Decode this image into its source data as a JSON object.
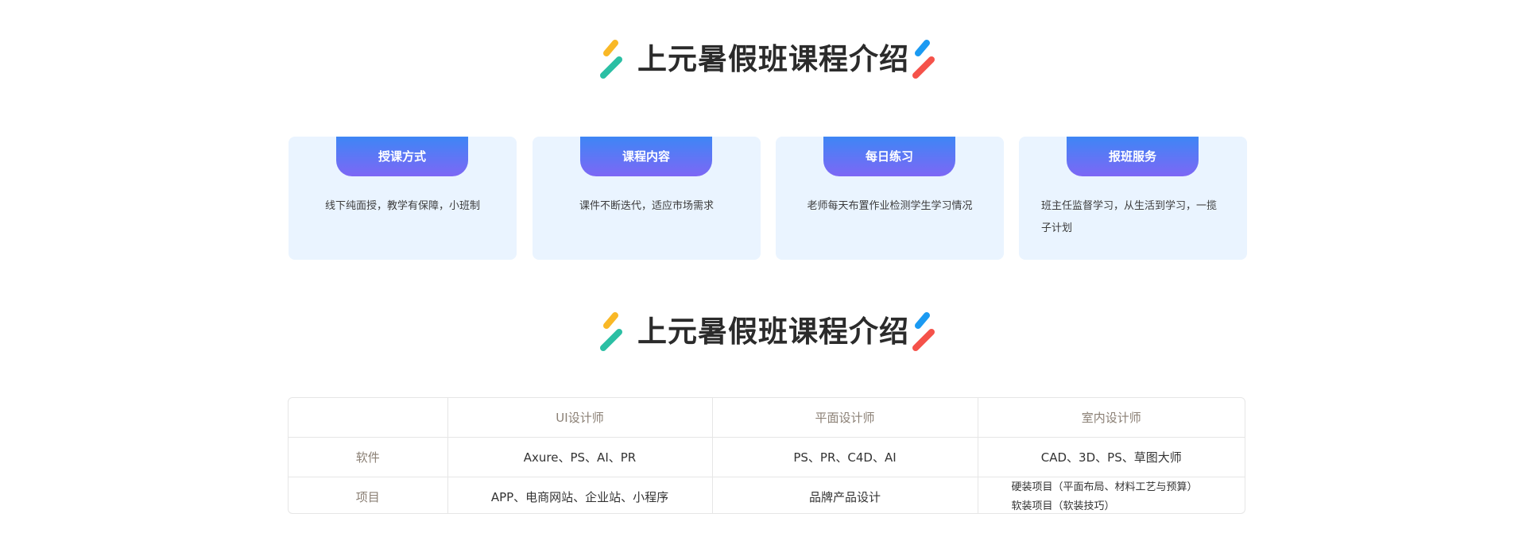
{
  "section1": {
    "title": "上元暑假班课程介绍",
    "cards": [
      {
        "label": "授课方式",
        "description": "线下纯面授，教学有保障，小班制"
      },
      {
        "label": "课程内容",
        "description": "课件不断迭代，适应市场需求"
      },
      {
        "label": "每日练习",
        "description": "老师每天布置作业检测学生学习情况"
      },
      {
        "label": "报班服务",
        "description": "班主任监督学习，从生活到学习，一揽子计划"
      }
    ]
  },
  "section2": {
    "title": "上元暑假班课程介绍",
    "table": {
      "headers": [
        "",
        "UI设计师",
        "平面设计师",
        "室内设计师"
      ],
      "rows": [
        {
          "label": "软件",
          "cells": [
            "Axure、PS、AI、PR",
            "PS、PR、C4D、AI",
            "CAD、3D、PS、草图大师"
          ]
        },
        {
          "label": "项目",
          "cells": [
            "APP、电商网站、企业站、小程序",
            "品牌产品设计",
            [
              "硬装项目（平面布局、材料工艺与预算）",
              "软装项目（软装技巧）"
            ]
          ]
        }
      ]
    }
  },
  "colors": {
    "deco_left_top": "#f9b826",
    "deco_left_bottom": "#2bbfa4",
    "deco_right_top": "#1b9af2",
    "deco_right_bottom": "#f5524a",
    "card_bg": "#eaf4ff",
    "tab_gradient_start": "#3e86f5",
    "tab_gradient_end": "#7d67f5"
  }
}
